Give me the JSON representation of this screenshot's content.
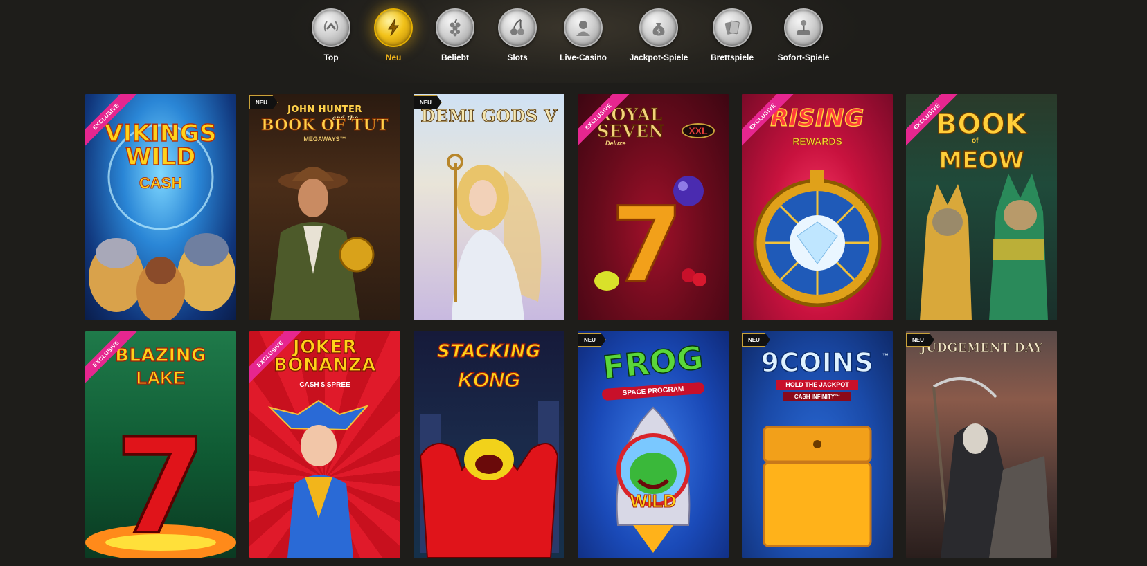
{
  "nav": {
    "items": [
      {
        "label": "Top",
        "icon": "crown-laurel-icon",
        "active": false
      },
      {
        "label": "Neu",
        "icon": "lightning-icon",
        "active": true
      },
      {
        "label": "Beliebt",
        "icon": "grapes-icon",
        "active": false
      },
      {
        "label": "Slots",
        "icon": "cherries-icon",
        "active": false
      },
      {
        "label": "Live-Casino",
        "icon": "dealer-icon",
        "active": false
      },
      {
        "label": "Jackpot-Spiele",
        "icon": "money-bag-icon",
        "active": false
      },
      {
        "label": "Brettspiele",
        "icon": "cards-icon",
        "active": false
      },
      {
        "label": "Sofort-Spiele",
        "icon": "joystick-icon",
        "active": false
      }
    ]
  },
  "badges": {
    "exclusive": "EXCLUSIVE",
    "new": "NEU"
  },
  "games": [
    {
      "title": "VIKINGS WILD",
      "subtitle": "CASH",
      "badge": "exclusive"
    },
    {
      "title": "BOOK OF TUT",
      "pretitle": "JOHN HUNTER",
      "pretitle_small": "and the",
      "subtitle": "MEGAWAYS™",
      "badge": "new"
    },
    {
      "title": "DEMI GODS V",
      "badge": "new"
    },
    {
      "title": "ROYAL SEVEN",
      "badge_xxl": "XXL",
      "subtitle": "Deluxe",
      "badge": "exclusive"
    },
    {
      "title": "RISING",
      "subtitle": "REWARDS",
      "badge": "exclusive"
    },
    {
      "title": "BOOK",
      "subtitle": "MEOW",
      "pretitle_small": "of",
      "badge": "exclusive"
    },
    {
      "title": "BLAZING",
      "subtitle": "LAKE",
      "badge": "exclusive"
    },
    {
      "title": "JOKER BONANZA",
      "subtitle": "CASH $ SPREE",
      "badge": "exclusive"
    },
    {
      "title": "STACKING",
      "subtitle": "KONG",
      "badge": "none"
    },
    {
      "title": "FROG",
      "subtitle": "SPACE PROGRAM",
      "label": "WILD",
      "badge": "new"
    },
    {
      "title": "9COINS",
      "title_mark": "™",
      "subtitle": "HOLD THE JACKPOT",
      "subtitle2": "CASH INFINITY™",
      "badge": "new"
    },
    {
      "title": "JUDGEMENT DAY",
      "badge": "new"
    }
  ],
  "colors": {
    "accent": "#f2b51b",
    "exclusive_ribbon": "#e6268f",
    "background": "#1e1d1a"
  }
}
